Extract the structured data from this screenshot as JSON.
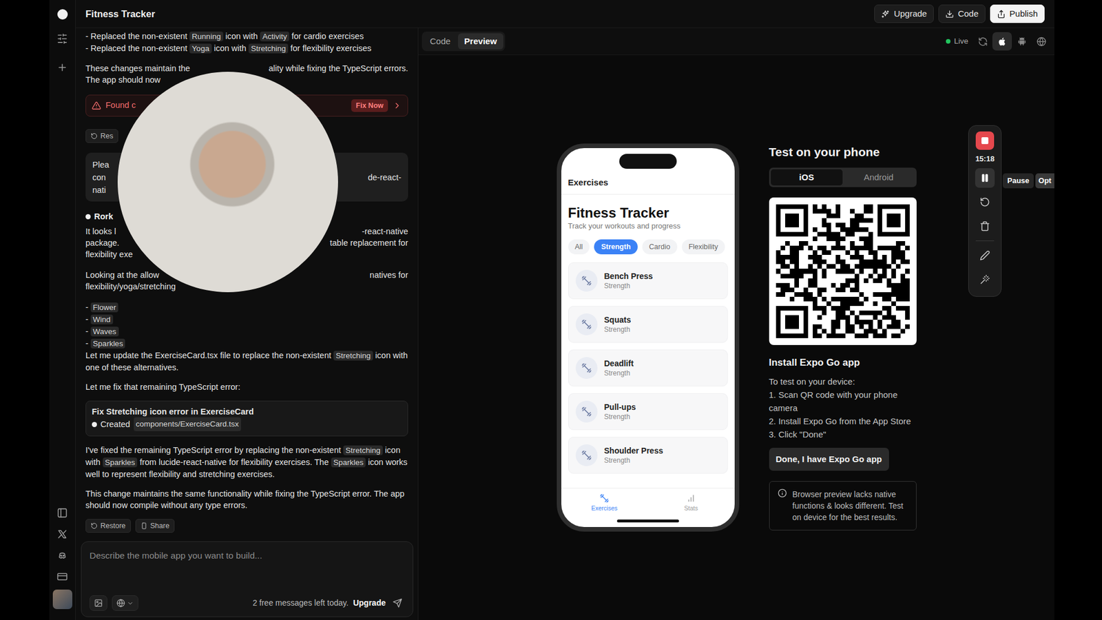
{
  "app": {
    "title": "Fitness Tracker"
  },
  "header_buttons": [
    {
      "label": "Upgrade",
      "kind": "ghost"
    },
    {
      "label": "Code",
      "kind": "ghost"
    },
    {
      "label": "Publish",
      "kind": "primary"
    }
  ],
  "chat": {
    "blocks": [
      {
        "kind": "para",
        "lines": [
          [
            {
              "kind": "text",
              "text": "- Replaced the non-existent "
            },
            {
              "kind": "code",
              "text": "Running"
            },
            {
              "kind": "text",
              "text": " icon with "
            },
            {
              "kind": "code",
              "text": "Activity"
            },
            {
              "kind": "text",
              "text": " for cardio exercises"
            }
          ],
          [
            {
              "kind": "text",
              "text": "- Replaced the non-existent "
            },
            {
              "kind": "code",
              "text": "Yoga"
            },
            {
              "kind": "text",
              "text": " icon with "
            },
            {
              "kind": "code",
              "text": "Stretching"
            },
            {
              "kind": "text",
              "text": " for flexibility exercises"
            }
          ]
        ]
      },
      {
        "kind": "region",
        "blocks": [
          {
            "kind": "split",
            "lines": [
              {
                "left": "These changes maintain the",
                "right": "ality while fixing the TypeScript errors."
              },
              {
                "left": "The app should now",
                "right": ""
              }
            ]
          },
          {
            "kind": "alert",
            "text": "Found c",
            "button": "Fix Now"
          },
          {
            "kind": "chip",
            "text": "Res"
          },
          {
            "kind": "user",
            "lines": [
              {
                "left": "Plea",
                "right": ""
              },
              {
                "left": "con",
                "right": "de-react-"
              },
              {
                "left": "nati",
                "right": ""
              }
            ]
          },
          {
            "kind": "author",
            "name": "Rork"
          },
          {
            "kind": "split",
            "lines": [
              {
                "left": "It looks l",
                "right": "-react-native"
              },
              {
                "left": "package.",
                "right": "table replacement for"
              },
              {
                "left": "flexibility exe",
                "right": ""
              }
            ]
          },
          {
            "kind": "split",
            "lines": [
              {
                "left": "Looking at the allow",
                "right": "natives for"
              },
              {
                "left": "flexibility/yoga/stretching",
                "right": ""
              }
            ]
          }
        ]
      },
      {
        "kind": "para",
        "lines": [
          [
            {
              "kind": "text",
              "text": "- "
            },
            {
              "kind": "code",
              "text": "Flower"
            }
          ],
          [
            {
              "kind": "text",
              "text": "- "
            },
            {
              "kind": "code",
              "text": "Wind"
            }
          ],
          [
            {
              "kind": "text",
              "text": "- "
            },
            {
              "kind": "code",
              "text": "Waves"
            }
          ],
          [
            {
              "kind": "text",
              "text": "- "
            },
            {
              "kind": "code",
              "text": "Sparkles"
            }
          ],
          [
            {
              "kind": "text",
              "text": "Let me update the ExerciseCard.tsx file to replace the non-existent "
            },
            {
              "kind": "code",
              "text": "Stretching"
            },
            {
              "kind": "text",
              "text": " icon with one of these alternatives."
            }
          ]
        ]
      },
      {
        "kind": "para",
        "lines": [
          [
            {
              "kind": "text",
              "text": "Let me fix that remaining TypeScript error:"
            }
          ]
        ]
      },
      {
        "kind": "tool",
        "title": "Fix Stretching icon error in ExerciseCard",
        "status": "Created",
        "path": "components/ExerciseCard.tsx"
      },
      {
        "kind": "para",
        "lines": [
          [
            {
              "kind": "text",
              "text": "I've fixed the remaining TypeScript error by replacing the non-existent "
            },
            {
              "kind": "code",
              "text": "Stretching"
            },
            {
              "kind": "text",
              "text": " icon with "
            },
            {
              "kind": "code",
              "text": "Sparkles"
            },
            {
              "kind": "text",
              "text": " from lucide-react-native for flexibility exercises. The "
            },
            {
              "kind": "code",
              "text": "Sparkles"
            },
            {
              "kind": "text",
              "text": " icon works well to represent flexibility and stretching exercises."
            }
          ]
        ]
      },
      {
        "kind": "para",
        "lines": [
          [
            {
              "kind": "text",
              "text": "This change maintains the same functionality while fixing the TypeScript error. The app should now compile without any type errors."
            }
          ]
        ]
      },
      {
        "kind": "actions",
        "buttons": [
          "Restore",
          "Share"
        ]
      }
    ],
    "input": {
      "placeholder": "Describe the mobile app you want to build...",
      "quota": "2 free messages left today.",
      "upgrade": "Upgrade"
    }
  },
  "preview": {
    "tabs": [
      {
        "label": "Code",
        "selected": false
      },
      {
        "label": "Preview",
        "selected": true
      }
    ],
    "live": "Live",
    "devices": [
      {
        "selected": true
      },
      {
        "selected": false
      },
      {
        "selected": false
      }
    ]
  },
  "phone": {
    "nav_title": "Exercises",
    "title": "Fitness Tracker",
    "subtitle": "Track your workouts and progress",
    "filters": [
      {
        "label": "All",
        "selected": false
      },
      {
        "label": "Strength",
        "selected": true
      },
      {
        "label": "Cardio",
        "selected": false
      },
      {
        "label": "Flexibility",
        "selected": false
      }
    ],
    "exercises": [
      {
        "name": "Bench Press",
        "category": "Strength"
      },
      {
        "name": "Squats",
        "category": "Strength"
      },
      {
        "name": "Deadlift",
        "category": "Strength"
      },
      {
        "name": "Pull-ups",
        "category": "Strength"
      },
      {
        "name": "Shoulder Press",
        "category": "Strength"
      }
    ],
    "tabs": [
      {
        "label": "Exercises",
        "selected": true
      },
      {
        "label": "Stats",
        "selected": false
      }
    ]
  },
  "test_panel": {
    "title": "Test on your phone",
    "os_tabs": [
      {
        "label": "iOS",
        "selected": true
      },
      {
        "label": "Android",
        "selected": false
      }
    ],
    "install_title": "Install Expo Go app",
    "intro": "To test on your device:",
    "steps": [
      "1. Scan QR code with your phone camera",
      "2. Install Expo Go from the App Store",
      "3. Click \"Done\""
    ],
    "done_button": "Done, I have Expo Go app",
    "note": "Browser preview lacks native functions & looks different. Test on device for the best results."
  },
  "recorder": {
    "time": "15:18",
    "tools": [
      {
        "hovered": true
      },
      {
        "hovered": false
      },
      {
        "hovered": false
      },
      {
        "hovered": false
      },
      {
        "hovered": false
      }
    ],
    "tooltips": [
      "Pause",
      "Opt"
    ]
  }
}
